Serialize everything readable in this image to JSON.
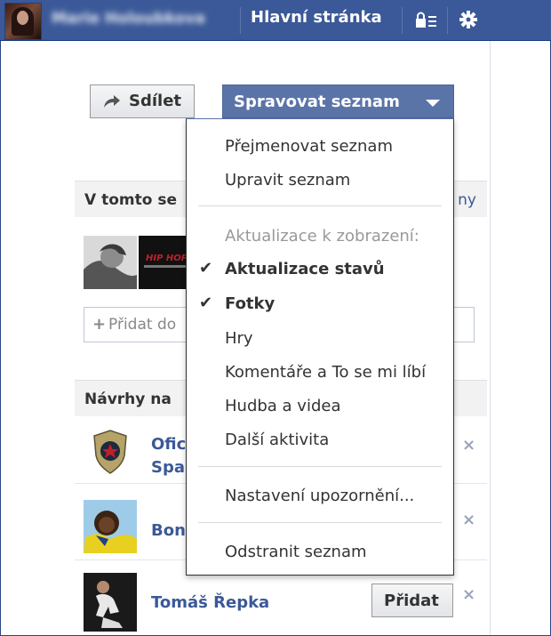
{
  "topbar": {
    "user_name": "Marie Holoubkova",
    "home_link": "Hlavní stránka",
    "lock_icon": "privacy-lock-icon",
    "gear_icon": "gear-icon"
  },
  "actions": {
    "share_label": "Sdílet",
    "manage_label": "Spravovat seznam"
  },
  "members_section": {
    "title": "V tomto se",
    "more_link": "ny"
  },
  "add_member": {
    "placeholder": "Přidat do"
  },
  "suggestions_section": {
    "title": "Návrhy na"
  },
  "suggestions": [
    {
      "name_line1": "Ofic",
      "name_line2": "Spa"
    },
    {
      "name_line1": "Bon"
    },
    {
      "name_line1": "Tomáš Řepka",
      "add_label": "Přidat"
    }
  ],
  "close_glyph": "×",
  "menu": {
    "rename": "Přejmenovat seznam",
    "edit": "Upravit seznam",
    "updates_header": "Aktualizace k zobrazení:",
    "status_updates": "Aktualizace stavů",
    "photos": "Fotky",
    "games": "Hry",
    "comments_likes": "Komentáře a To se mi líbí",
    "music_video": "Hudba a videa",
    "other_activity": "Další aktivita",
    "notifications": "Nastavení upozornění...",
    "delete": "Odstranit seznam",
    "check_glyph": "✔"
  },
  "colors": {
    "brand": "#3b5998",
    "manage_button": "#5b74a8"
  }
}
